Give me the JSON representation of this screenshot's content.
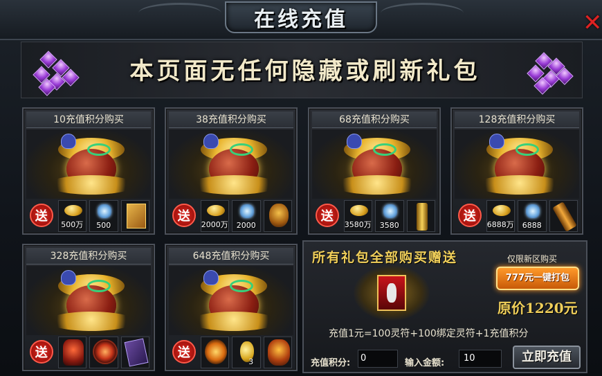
{
  "header": {
    "title": "在线充值",
    "close_icon": "close-icon"
  },
  "banner": {
    "text": "本页面无任何隐藏或刷新礼包"
  },
  "packs": [
    {
      "title": "10充值积分购买",
      "gift": "送",
      "items": [
        {
          "icon": "gold-ingot-icon",
          "qty": "500万"
        },
        {
          "icon": "crystal-icon",
          "qty": "500"
        },
        {
          "icon": "skill-book-icon",
          "qty": ""
        }
      ]
    },
    {
      "title": "38充值积分购买",
      "gift": "送",
      "items": [
        {
          "icon": "gold-ingot-icon",
          "qty": "2000万"
        },
        {
          "icon": "crystal-icon",
          "qty": "2000"
        },
        {
          "icon": "golden-skull-icon",
          "qty": ""
        }
      ]
    },
    {
      "title": "68充值积分购买",
      "gift": "送",
      "items": [
        {
          "icon": "gold-ingot-icon",
          "qty": "3580万"
        },
        {
          "icon": "crystal-icon",
          "qty": "3580"
        },
        {
          "icon": "golden-scroll-icon",
          "qty": ""
        }
      ]
    },
    {
      "title": "128充值积分购买",
      "gift": "送",
      "items": [
        {
          "icon": "gold-ingot-icon",
          "qty": "6888万"
        },
        {
          "icon": "crystal-icon",
          "qty": "6888"
        },
        {
          "icon": "golden-tool-icon",
          "qty": ""
        }
      ]
    },
    {
      "title": "328充值积分购买",
      "gift": "送",
      "items": [
        {
          "icon": "demon-warrior-icon",
          "qty": ""
        },
        {
          "icon": "fire-wheel-icon",
          "qty": ""
        },
        {
          "icon": "purple-tome-icon",
          "qty": ""
        }
      ]
    },
    {
      "title": "648充值积分购买",
      "gift": "送",
      "items": [
        {
          "icon": "flame-emblem-icon",
          "qty": ""
        },
        {
          "icon": "golden-gourd-icon",
          "qty": "3"
        },
        {
          "icon": "golden-mask-icon",
          "qty": ""
        }
      ]
    }
  ],
  "bundle": {
    "title": "所有礼包全部购买赠送",
    "new_only": "仅限新区购买",
    "pack_button": "777元一键打包",
    "original_price": "原价1220元",
    "rate": "充值1元=100灵符+100绑定灵符+1充值积分",
    "score_label": "充值积分:",
    "score_value": "0",
    "amount_label": "输入金额:",
    "amount_value": "10",
    "recharge_button": "立即充值"
  },
  "colors": {
    "gold_text": "#f0cf5a",
    "gift_red": "#e0261e",
    "pack_orange": "#ff9a2a"
  }
}
